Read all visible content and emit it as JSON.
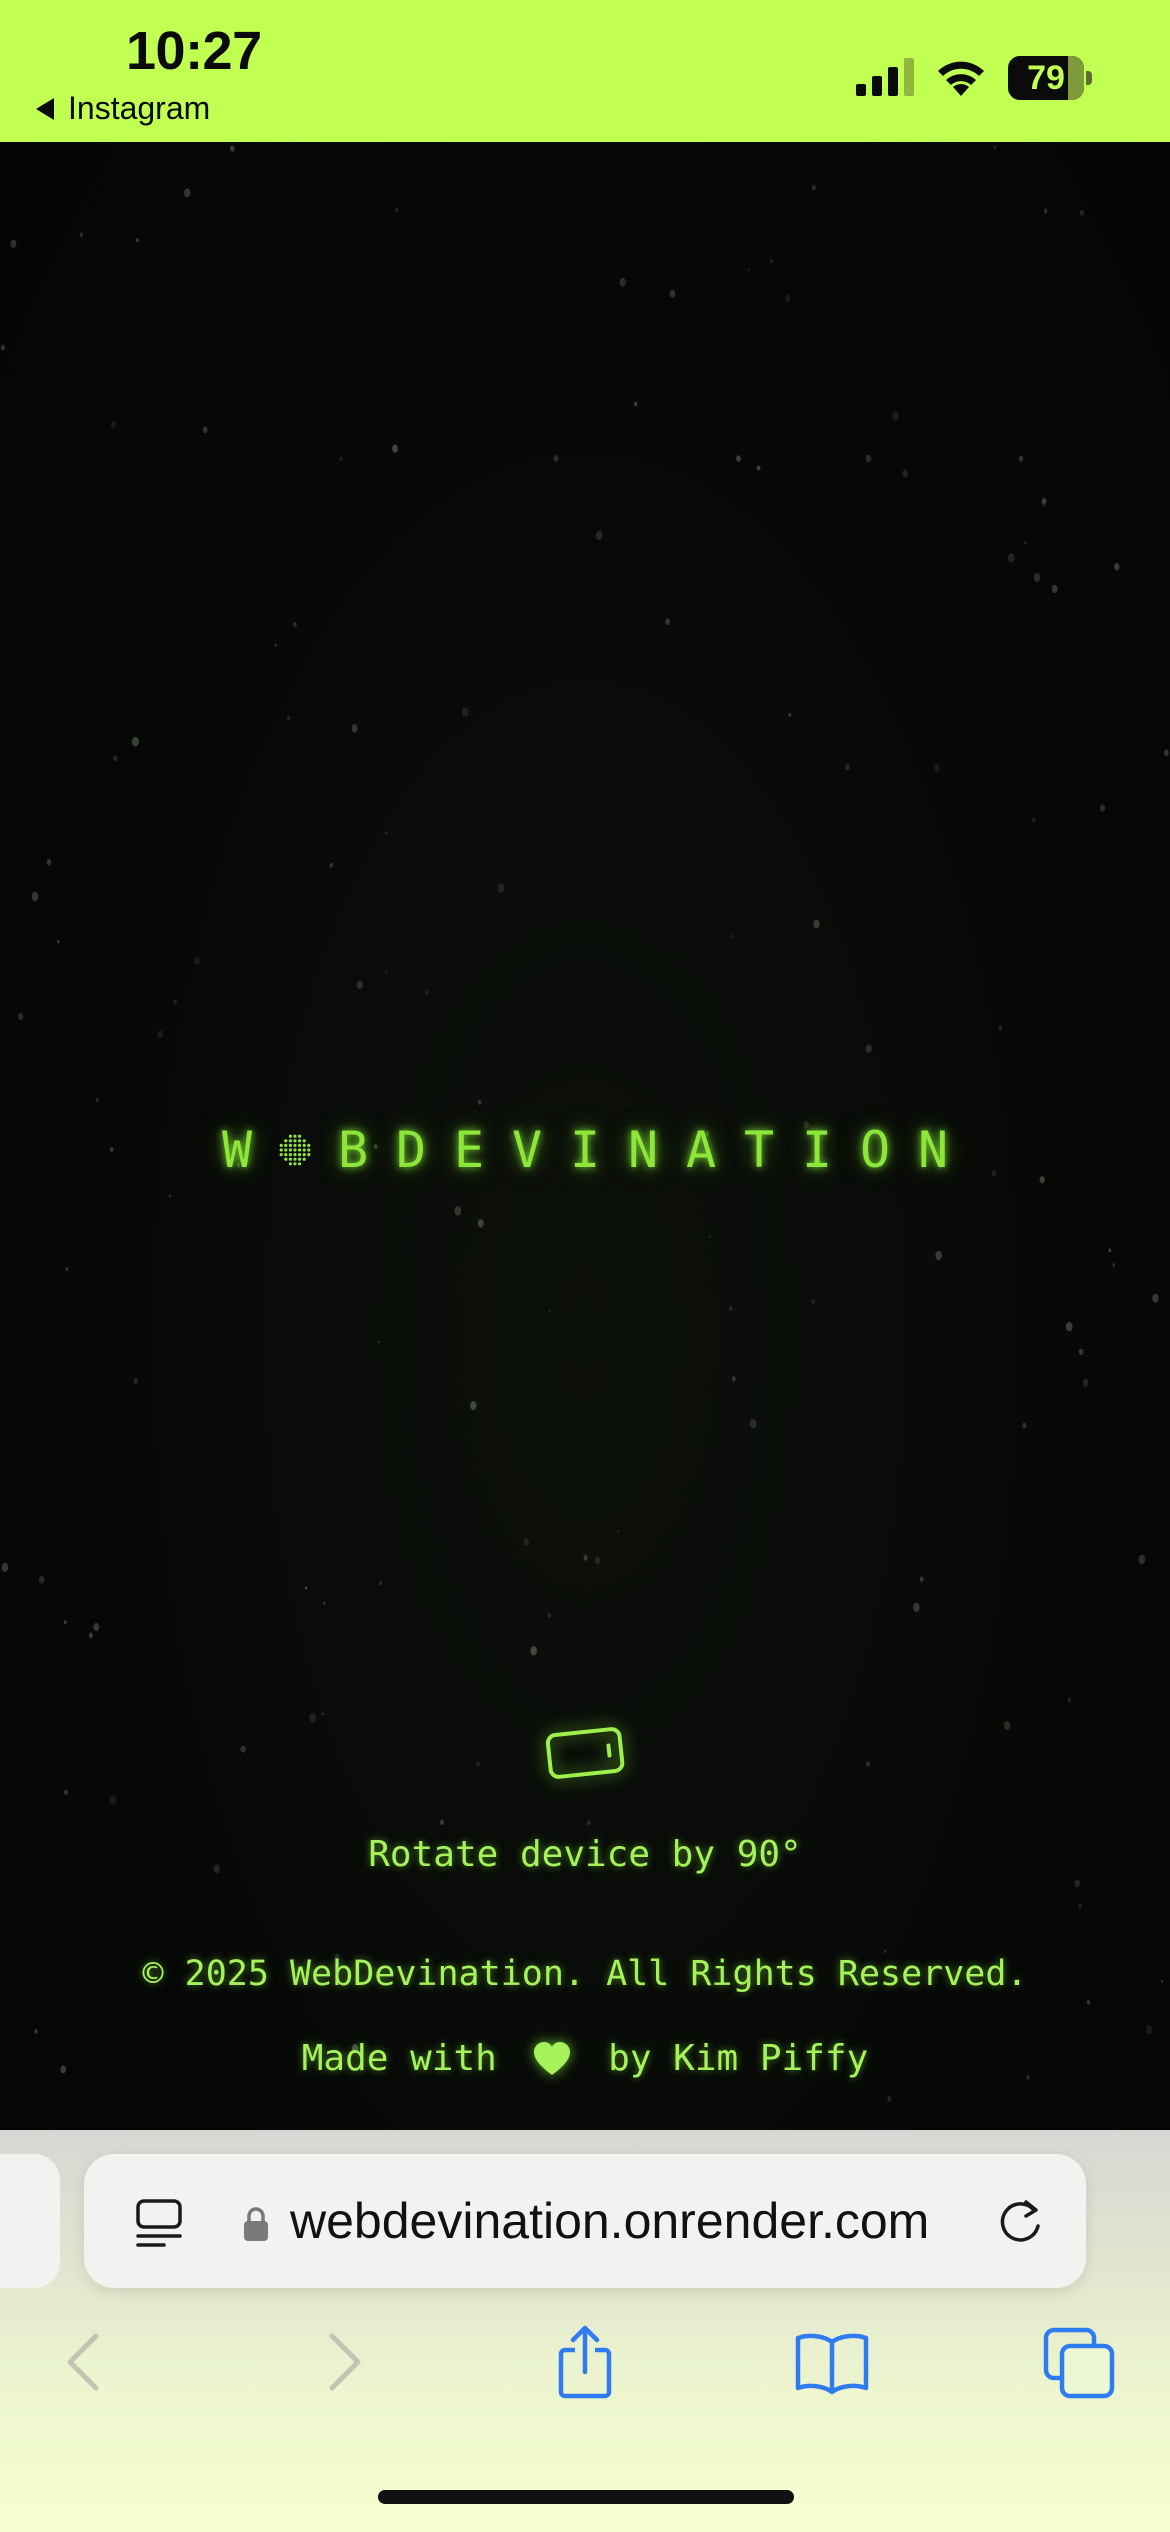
{
  "status_bar": {
    "time": "10:27",
    "back_app": "Instagram",
    "battery_level": "79",
    "battery_percent": 79,
    "signal_bars_active": 3,
    "background_color": "#c1ff52"
  },
  "page": {
    "logo": {
      "letters": [
        "W",
        "",
        "B",
        "D",
        "E",
        "V",
        "I",
        "N",
        "A",
        "T",
        "I",
        "O",
        "N"
      ],
      "color": "#8fe63a"
    },
    "rotate_icon": "phone-landscape-icon",
    "rotate_text": "Rotate device by 90°",
    "copyright": "© 2025 WebDevination. All Rights Reserved.",
    "made_with": {
      "before": "Made with ",
      "icon": "heart-icon",
      "after": " by Kim Piffy"
    },
    "accent_color": "#a6f25a"
  },
  "browser": {
    "url": "webdevination.onrender.com",
    "reader_icon": "reader-mode-icon",
    "lock_icon": "lock-icon",
    "reload_icon": "reload-icon",
    "toolbar": {
      "back": "chevron-left-icon",
      "forward": "chevron-right-icon",
      "share": "share-icon",
      "bookmarks": "book-icon",
      "tabs": "tabs-icon"
    },
    "accent_color": "#2f7bf0"
  }
}
